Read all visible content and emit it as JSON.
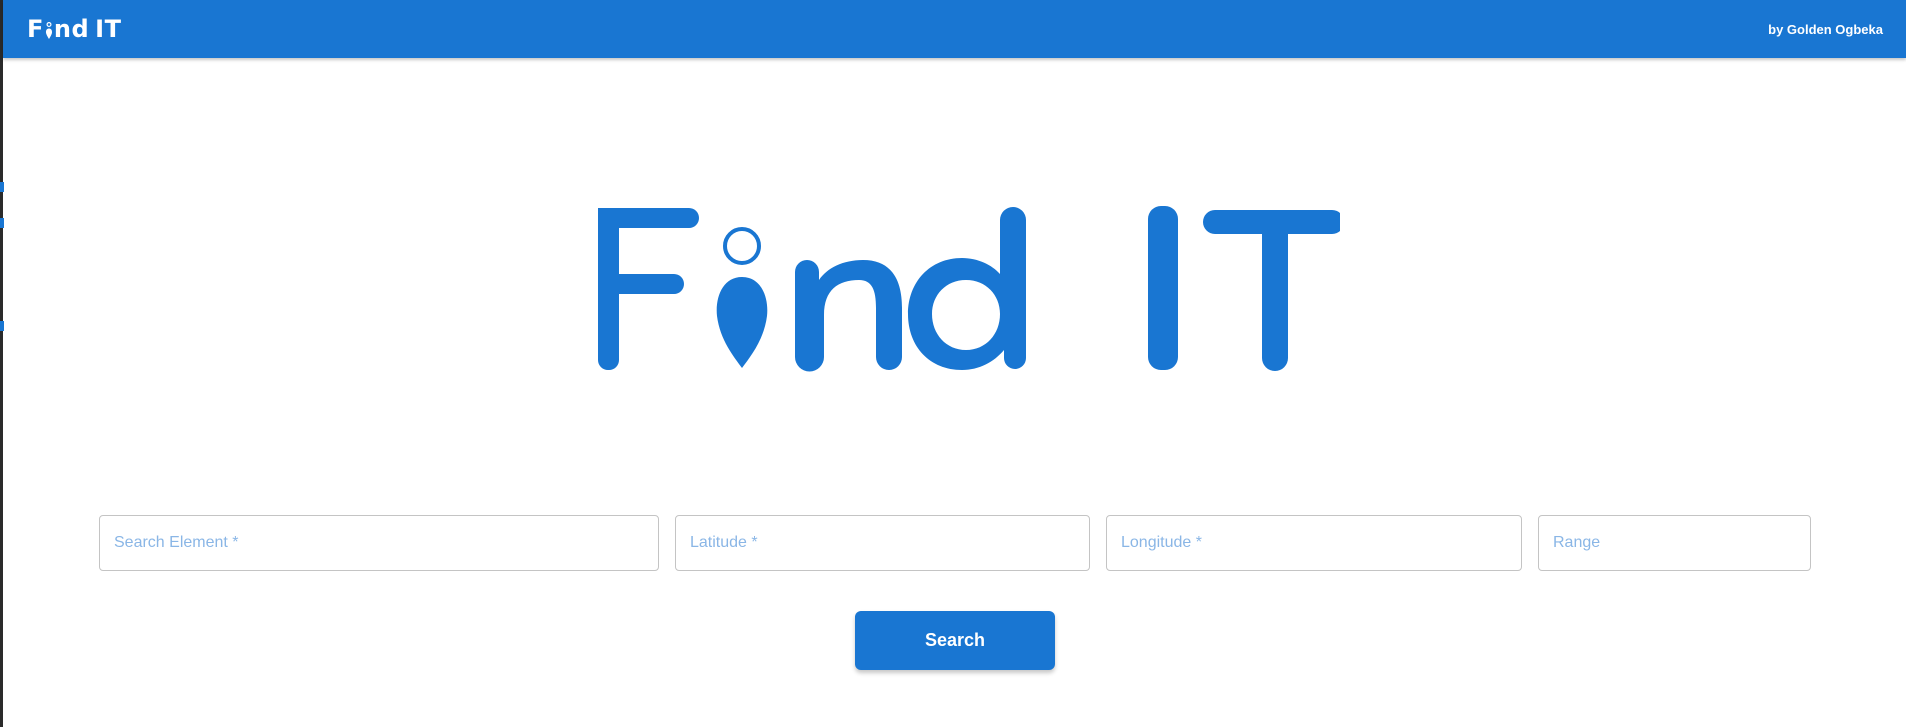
{
  "header": {
    "brand": {
      "first_letter": "F",
      "rest_of_word": "nd",
      "second_word": "IT"
    },
    "author": "by Golden Ogbeka"
  },
  "hero": {
    "icon": "location-pin-icon"
  },
  "form": {
    "search_element_placeholder": "Search Element *",
    "latitude_placeholder": "Latitude *",
    "longitude_placeholder": "Longitude *",
    "range_placeholder": "Range",
    "search_element_value": "",
    "latitude_value": "",
    "longitude_value": "",
    "range_value": ""
  },
  "search_button": {
    "label": "Search"
  },
  "colors": {
    "primary": "#1976d2",
    "placeholder": "#8ab6e6",
    "border": "#c4c4c4",
    "background": "#ffffff"
  }
}
